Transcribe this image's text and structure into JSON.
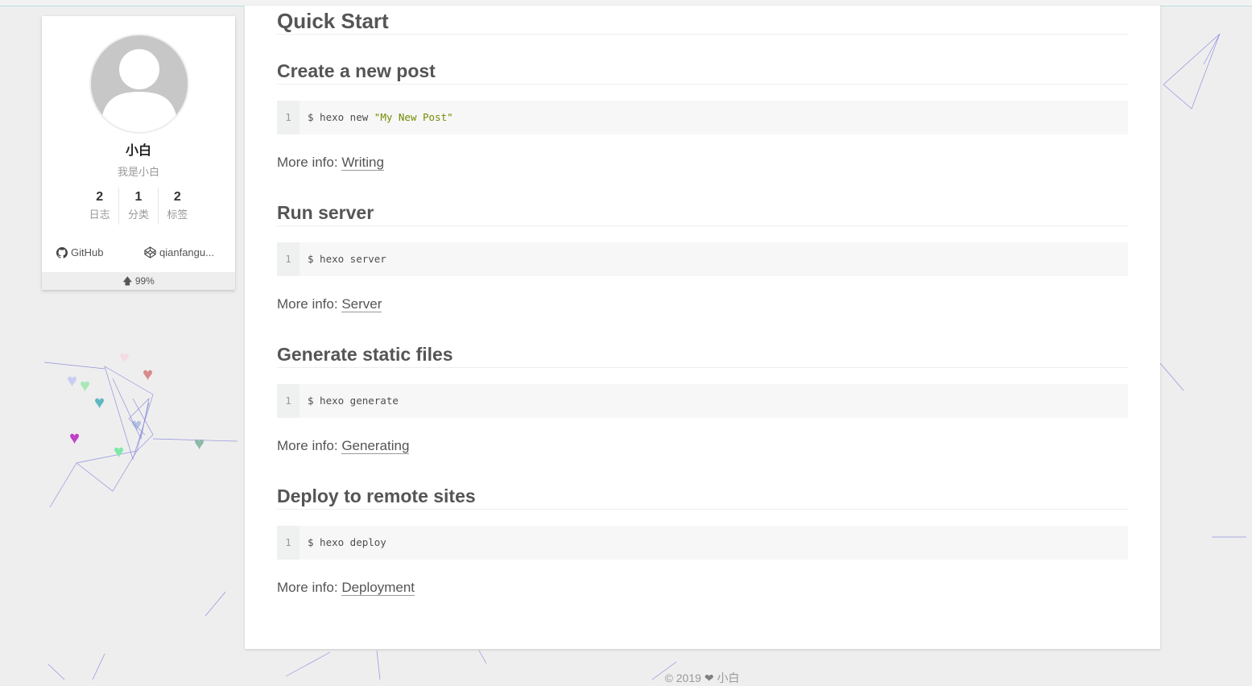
{
  "sidebar": {
    "author_name": "小白",
    "author_description": "我是小白",
    "stats": [
      {
        "count": "2",
        "label": "日志"
      },
      {
        "count": "1",
        "label": "分类"
      },
      {
        "count": "2",
        "label": "标签"
      }
    ],
    "links": [
      {
        "label": "GitHub",
        "icon": "github-icon"
      },
      {
        "label": "qianfangu...",
        "icon": "codepen-icon"
      }
    ],
    "progress": "99%"
  },
  "post": {
    "title": "Quick Start",
    "sections": [
      {
        "heading": "Create a new post",
        "line_number": "1",
        "code_prefix": "$ hexo new ",
        "code_string": "\"My New Post\"",
        "info_label": "More info: ",
        "info_link": "Writing"
      },
      {
        "heading": "Run server",
        "line_number": "1",
        "code_prefix": "$ hexo server",
        "code_string": "",
        "info_label": "More info: ",
        "info_link": "Server"
      },
      {
        "heading": "Generate static files",
        "line_number": "1",
        "code_prefix": "$ hexo generate",
        "code_string": "",
        "info_label": "More info: ",
        "info_link": "Generating"
      },
      {
        "heading": "Deploy to remote sites",
        "line_number": "1",
        "code_prefix": "$ hexo deploy",
        "code_string": "",
        "info_label": "More info: ",
        "info_link": "Deployment"
      }
    ]
  },
  "footer": {
    "year": "© 2019",
    "author": "小白"
  },
  "colors": {
    "code_string": "#718c00",
    "background": "#eeeeee",
    "decor_lines": "#7b7bdc"
  }
}
